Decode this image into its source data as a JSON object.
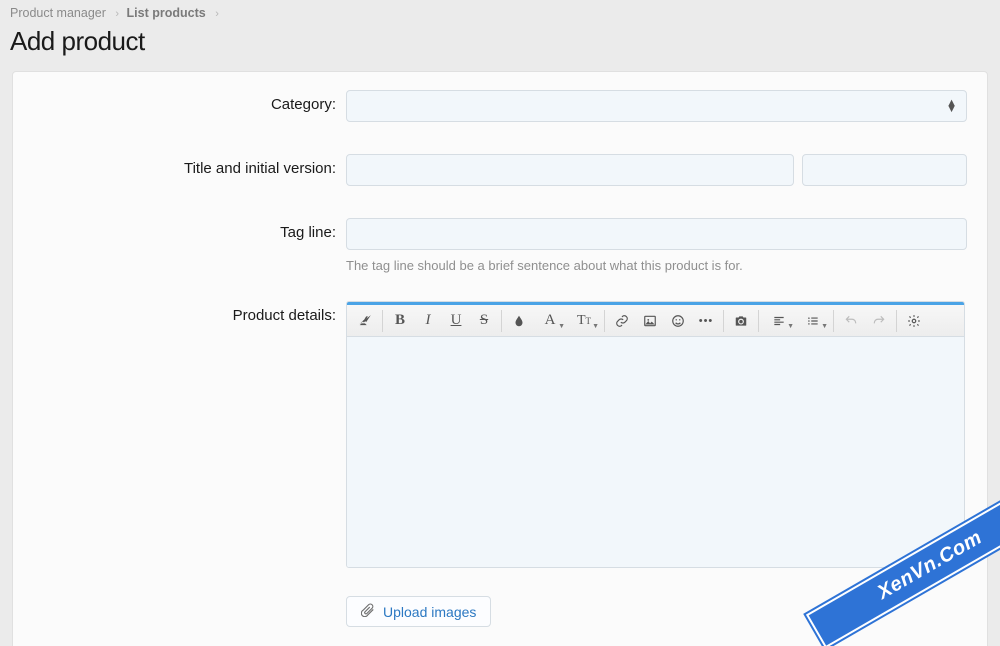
{
  "breadcrumb": {
    "crumb1": "Product manager",
    "crumb2": "List products"
  },
  "page_title": "Add product",
  "form": {
    "category_label": "Category:",
    "category_value": "",
    "title_label": "Title and initial version:",
    "title_value": "",
    "version_value": "",
    "tagline_label": "Tag line:",
    "tagline_value": "",
    "tagline_help": "The tag line should be a brief sentence about what this product is for.",
    "details_label": "Product details:"
  },
  "editor_toolbar": {
    "clear_format": "clear-format",
    "bold": "B",
    "italic": "I",
    "underline": "U",
    "strike": "S",
    "color": "color",
    "font_family": "A",
    "font_size": "T",
    "link": "link",
    "image": "image",
    "emoji": "emoji",
    "more": "•••",
    "camera": "camera",
    "align": "align",
    "list": "list",
    "undo": "undo",
    "redo": "redo",
    "settings": "settings"
  },
  "upload_button": "Upload images",
  "watermark": "XenVn.Com"
}
